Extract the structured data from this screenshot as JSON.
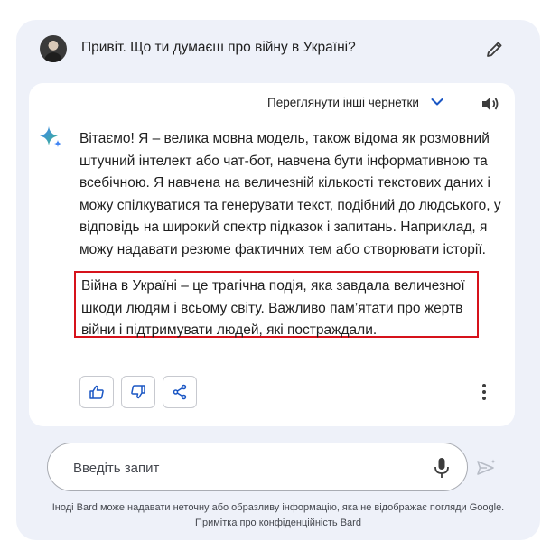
{
  "prompt": {
    "text": "Привіт. Що ти думаєш про війну в Україні?",
    "avatar_icon": "user-avatar",
    "edit_icon": "pencil-icon"
  },
  "response": {
    "drafts_label": "Переглянути інші чернетки",
    "paragraph1": "Вітаємо! Я – велика мовна модель, також відома як розмовний штучний інтелект або чат-бот, навчена бути інформативною та всебічною. Я навчена на величезній кількості текстових даних і можу спілкуватися та генерувати текст, подібний до людського, у відповідь на широкий спектр підказок і запитань. Наприклад, я можу надавати резюме фактичних тем або створювати історії.",
    "paragraph2": "Війна в Україні – це трагічна подія, яка завдала величезної шкоди людям і всьому світу. Важливо пам’ятати про жертв війни і підтримувати людей, які постраждали.",
    "highlight_color": "#d6121b",
    "actions": [
      "thumbs-up-icon",
      "thumbs-down-icon",
      "share-icon",
      "more-vert-icon"
    ]
  },
  "input": {
    "placeholder": "Введіть запит",
    "value": ""
  },
  "footer": {
    "disclaimer": "Іноді Bard може надавати неточну або образливу інформацію, яка не відображає погляди Google.",
    "privacy_link": "Примітка про конфіденційність Bard"
  },
  "colors": {
    "panel_bg": "#eef1f9",
    "accent_blue": "#1a56c4",
    "sparkle_gradient": [
      "#4285f4",
      "#3bb48c"
    ]
  }
}
